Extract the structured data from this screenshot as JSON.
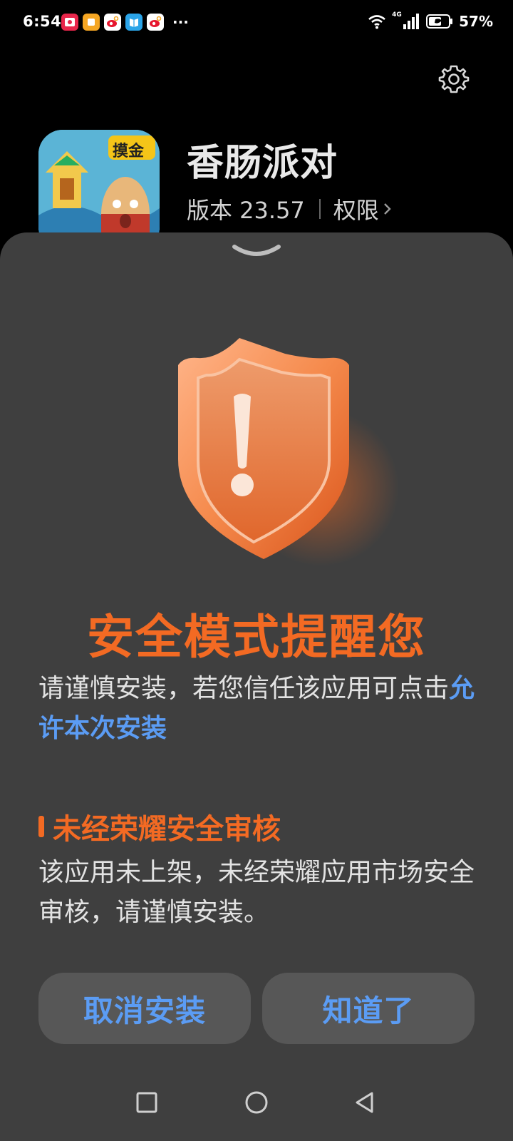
{
  "status_bar": {
    "time": "6:54",
    "more": "···",
    "battery": "57%",
    "network": "4G"
  },
  "app": {
    "name": "香肠派对",
    "version": "版本 23.57",
    "permissions": "权限",
    "icon_badge": "摸金"
  },
  "dialog": {
    "title": "安全模式提醒您",
    "desc_prefix": "请谨慎安装，若您信任该应用可点击",
    "allow_link": "允许本次安装",
    "warning_heading": "未经荣耀安全审核",
    "warning_desc": "该应用未上架，未经荣耀应用市场安全审核，请谨慎安装。",
    "cancel_button": "取消安装",
    "ok_button": "知道了"
  },
  "colors": {
    "accent_orange": "#f36a23",
    "link_blue": "#5b9cf4",
    "sheet_bg": "#3f3f3f",
    "button_bg": "#575757"
  }
}
